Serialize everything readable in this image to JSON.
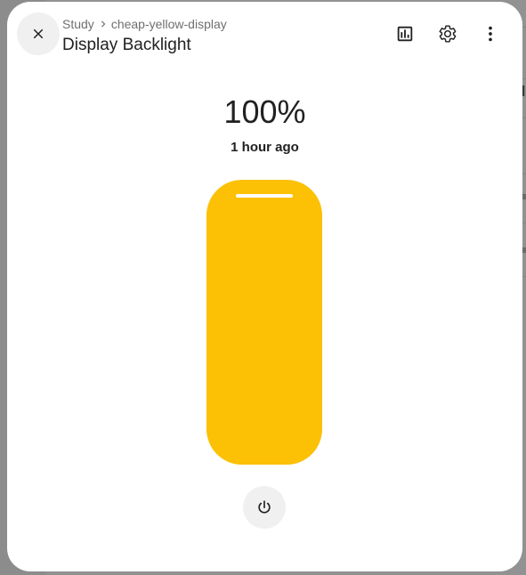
{
  "header": {
    "breadcrumb": {
      "area": "Study",
      "device": "cheap-yellow-display"
    },
    "title": "Display Backlight",
    "icons": {
      "close": "close-icon",
      "breadcrumb_separator": "chevron-right-icon",
      "history": "chart-box-icon",
      "settings": "gear-icon",
      "more": "dots-vertical-icon"
    }
  },
  "state": {
    "value": "100%",
    "last_changed": "1 hour ago"
  },
  "slider": {
    "level_percent": 100,
    "fill_color": "#fcc005",
    "track_color": "#f6e7b6"
  },
  "power": {
    "icon": "power-icon"
  }
}
